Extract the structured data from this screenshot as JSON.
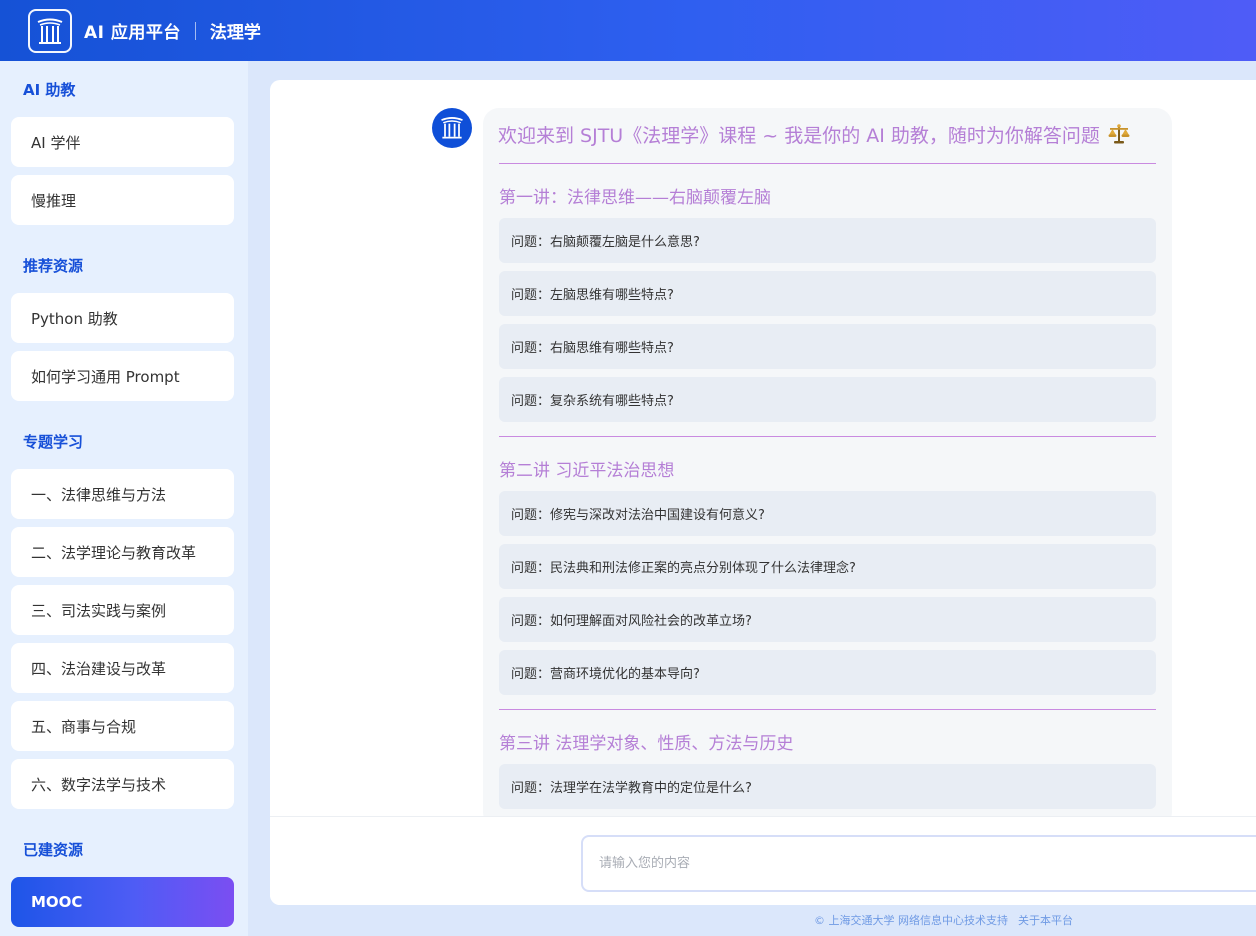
{
  "header": {
    "app_name": "AI 应用平台",
    "course_name": "法理学"
  },
  "sidebar": {
    "sections": [
      {
        "title": "AI 助教",
        "items": [
          "AI 学伴",
          "慢推理"
        ]
      },
      {
        "title": "推荐资源",
        "items": [
          "Python 助教",
          "如何学习通用 Prompt"
        ]
      },
      {
        "title": "专题学习",
        "items": [
          "一、法律思维与方法",
          "二、法学理论与教育改革",
          "三、司法实践与案例",
          "四、法治建设与改革",
          "五、商事与合规",
          "六、数字法学与技术"
        ]
      },
      {
        "title": "已建资源",
        "items": [
          "MOOC"
        ]
      }
    ],
    "active_item": "MOOC"
  },
  "chat": {
    "welcome": "欢迎来到 SJTU《法理学》课程 ~ 我是你的 AI 助教，随时为你解答问题",
    "welcome_icon": "scale-icon",
    "lectures": [
      {
        "title": "第一讲：法律思维——右脑颠覆左脑",
        "questions": [
          "问题：右脑颠覆左脑是什么意思?",
          "问题：左脑思维有哪些特点?",
          "问题：右脑思维有哪些特点?",
          "问题：复杂系统有哪些特点?"
        ]
      },
      {
        "title": "第二讲 习近平法治思想",
        "questions": [
          "问题：修宪与深改对法治中国建设有何意义?",
          "问题：民法典和刑法修正案的亮点分别体现了什么法律理念?",
          "问题：如何理解面对风险社会的改革立场?",
          "问题：营商环境优化的基本导向?"
        ]
      },
      {
        "title": "第三讲 法理学对象、性质、方法与历史",
        "questions": [
          "问题：法理学在法学教育中的定位是什么?"
        ]
      }
    ]
  },
  "input": {
    "placeholder": "请输入您的内容"
  },
  "footer": {
    "copyright": "© 上海交通大学 网络信息中心技术支持",
    "about": "关于本平台"
  },
  "colors": {
    "primary": "#1750d8",
    "accent_purple": "#b57fd6",
    "sidebar_bg": "#e6f0fe"
  }
}
